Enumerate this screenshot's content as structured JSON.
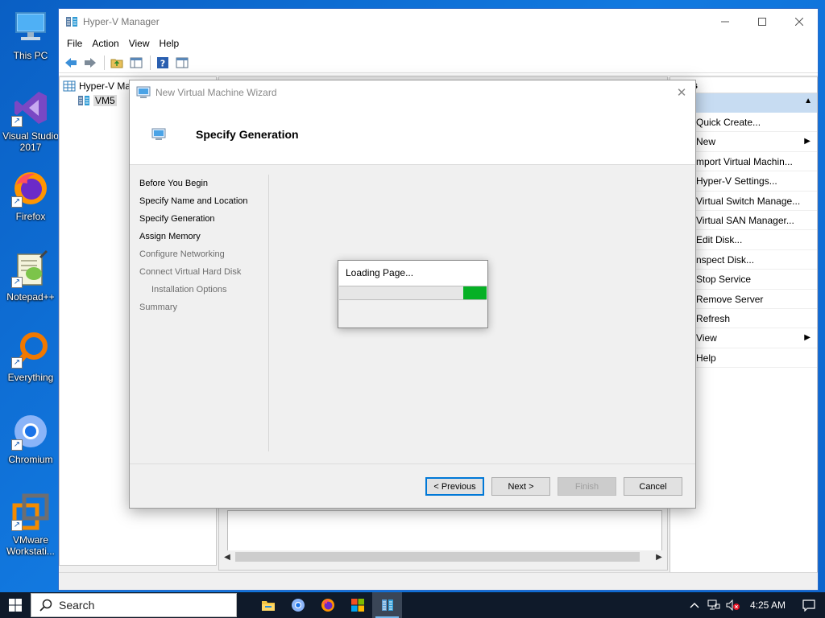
{
  "desktop": {
    "icons": [
      {
        "label": "This PC",
        "icon": "this-pc-icon"
      },
      {
        "label": "Visual Studio 2017",
        "icon": "visual-studio-icon"
      },
      {
        "label": "Firefox",
        "icon": "firefox-icon"
      },
      {
        "label": "Notepad++",
        "icon": "notepad-plus-plus-icon"
      },
      {
        "label": "Everything",
        "icon": "everything-search-icon"
      },
      {
        "label": "Chromium",
        "icon": "chromium-icon"
      },
      {
        "label": "VMware Workstati...",
        "icon": "vmware-icon"
      }
    ]
  },
  "main_window": {
    "title": "Hyper-V Manager",
    "menu": [
      "File",
      "Action",
      "View",
      "Help"
    ],
    "tree": {
      "root": "Hyper-V Ma",
      "child": "VM5"
    },
    "actions": {
      "header": "ns",
      "items": [
        {
          "label": "Quick Create...",
          "submenu": false
        },
        {
          "label": "New",
          "submenu": true
        },
        {
          "label": "mport Virtual Machin...",
          "submenu": false
        },
        {
          "label": "Hyper-V Settings...",
          "submenu": false
        },
        {
          "label": "Virtual Switch Manage...",
          "submenu": false
        },
        {
          "label": "Virtual SAN Manager...",
          "submenu": false
        },
        {
          "label": "Edit Disk...",
          "submenu": false
        },
        {
          "label": "nspect Disk...",
          "submenu": false
        },
        {
          "label": "Stop Service",
          "submenu": false
        },
        {
          "label": "Remove Server",
          "submenu": false
        },
        {
          "label": "Refresh",
          "submenu": false
        },
        {
          "label": "View",
          "submenu": true
        },
        {
          "label": "Help",
          "submenu": false
        }
      ]
    }
  },
  "wizard": {
    "title": "New Virtual Machine Wizard",
    "header": "Specify Generation",
    "steps": [
      {
        "label": "Before You Begin",
        "state": "active",
        "indent": false
      },
      {
        "label": "Specify Name and Location",
        "state": "active",
        "indent": false
      },
      {
        "label": "Specify Generation",
        "state": "active",
        "indent": false
      },
      {
        "label": "Assign Memory",
        "state": "active",
        "indent": false
      },
      {
        "label": "Configure Networking",
        "state": "inactive",
        "indent": false
      },
      {
        "label": "Connect Virtual Hard Disk",
        "state": "inactive",
        "indent": false
      },
      {
        "label": "Installation Options",
        "state": "inactive",
        "indent": true
      },
      {
        "label": "Summary",
        "state": "inactive",
        "indent": false
      }
    ],
    "loading": {
      "text": "Loading Page...",
      "progress_start": 0.84,
      "progress_end": 1.0
    },
    "buttons": {
      "previous": "< Previous",
      "next": "Next >",
      "finish": "Finish",
      "cancel": "Cancel"
    }
  },
  "taskbar": {
    "search_placeholder": "Search",
    "apps": [
      "file-explorer-icon",
      "chromium-icon",
      "firefox-icon",
      "microsoft-store-icon",
      "hyper-v-manager-icon"
    ],
    "clock": "4:25 AM"
  },
  "colors": {
    "accent": "#0078d7",
    "progress": "#06b025",
    "desktop": "#1279e0"
  }
}
